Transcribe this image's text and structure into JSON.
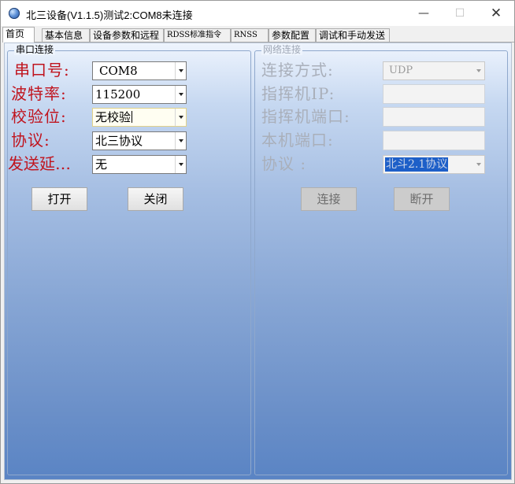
{
  "window": {
    "title": "北三设备(V1.1.5)测试2:COM8未连接",
    "minimize_glyph": "—",
    "maximize_glyph": "☐",
    "close_glyph": "✕"
  },
  "tabs": [
    {
      "label": "首页",
      "active": true
    },
    {
      "label": "基本信息"
    },
    {
      "label": "设备参数和远程"
    },
    {
      "label": "RDSS标准指令"
    },
    {
      "label": "RNSS"
    },
    {
      "label": "参数配置"
    },
    {
      "label": "调试和手动发送"
    }
  ],
  "serial": {
    "title": "串口连接",
    "port_label": "串口号:",
    "port_value": "COM8",
    "baud_label": "波特率:",
    "baud_value": "115200",
    "parity_label": "校验位:",
    "parity_value": "无校验",
    "protocol_label": "协议:",
    "protocol_value": "北三协议",
    "delay_label": "发送延…",
    "delay_value": "无",
    "open_button": "打开",
    "close_button": "关闭"
  },
  "network": {
    "title": "网络连接",
    "mode_label": "连接方式:",
    "mode_value": "UDP",
    "host_ip_label": "指挥机IP:",
    "host_ip_value": "",
    "host_port_label": "指挥机端口:",
    "host_port_value": "",
    "local_port_label": "本机端口:",
    "local_port_value": "",
    "protocol_label": "协议 :",
    "protocol_value": "北斗2.1协议",
    "connect_button": "连接",
    "disconnect_button": "断开"
  },
  "colors": {
    "label_red": "#c0141e",
    "disabled_gray": "#a9afba",
    "selection_blue": "#1d5fc8"
  }
}
